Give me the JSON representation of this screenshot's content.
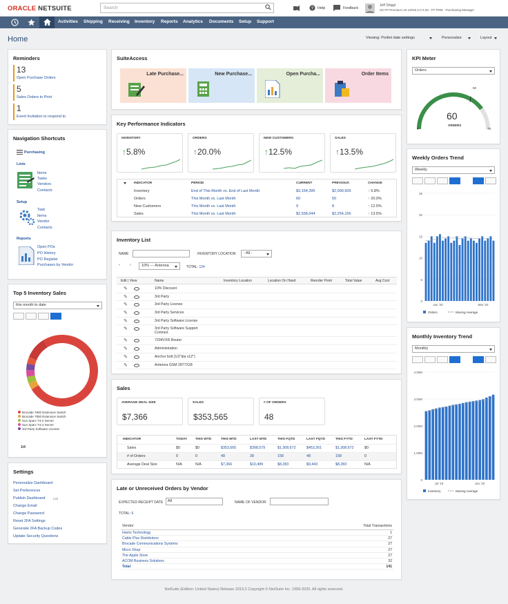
{
  "header": {
    "logo_oracle": "ORACLE",
    "logo_netsuite": "NETSUITE",
    "search_placeholder": "Search",
    "help": "Help",
    "feedback": "Feedback",
    "user_name": "Jeff Shippi",
    "user_role": "SS FP Premium US v2019.2.0 3.25 - FF PRM - Purchasing Manager"
  },
  "nav": {
    "items": [
      "Activities",
      "Shipping",
      "Receiving",
      "Inventory",
      "Reports",
      "Analytics",
      "Documents",
      "Setup",
      "Support"
    ]
  },
  "page": {
    "title": "Home",
    "viewing": "Viewing: Portlet date settings",
    "personalize": "Personalize",
    "layout": "Layout"
  },
  "reminders": {
    "title": "Reminders",
    "items": [
      {
        "count": "13",
        "label": "Open Purchase Orders",
        "color": "#e39a1e"
      },
      {
        "count": "5",
        "label": "Sales Orders to Print",
        "color": "#e39a1e"
      },
      {
        "count": "1",
        "label": "Event Invitation to respond to",
        "color": "#e39a1e"
      }
    ]
  },
  "navshortcuts": {
    "title": "Navigation Shortcuts",
    "purchasing": "Purchasing",
    "lists_label": "Lists",
    "lists": [
      "Items",
      "Tasks",
      "Vendors",
      "Contacts"
    ],
    "setup_label": "Setup",
    "setup": [
      "Task",
      "Items",
      "Vendor",
      "Contacts"
    ],
    "reports_label": "Reports",
    "reports": [
      "Open POs",
      "PO History",
      "PO Register",
      "Purchases by Vendor"
    ]
  },
  "top5": {
    "title": "Top 5 Inventory Sales",
    "range": "this month to date",
    "legend": [
      "Brocade 7800 Extension Switch",
      "Brocade 7800 Extension Switch",
      "Sun Sparc T4-2 Server",
      "Sun Sparc T4-2 Server",
      "3rd Party Software License"
    ],
    "pager": "1/4"
  },
  "settings": {
    "title": "Settings",
    "items": [
      "Personalize Dashboard",
      "Set Preferences",
      "Publish Dashboard",
      "Change Email",
      "Change Password",
      "Reset 2FA Settings",
      "Generate 2FA Backup Codes",
      "Update Security Questions"
    ],
    "publish_badge": "List"
  },
  "suiteaccess": {
    "title": "SuiteAccess",
    "tiles": [
      {
        "label": "Late Purchase...",
        "bg": "#fbe1d4"
      },
      {
        "label": "New Purchase...",
        "bg": "#d6e6f6"
      },
      {
        "label": "Open Purcha...",
        "bg": "#e4eed8"
      },
      {
        "label": "Order Items",
        "bg": "#f9d9e1"
      }
    ]
  },
  "kpi": {
    "title": "Key Performance Indicators",
    "boxes": [
      {
        "label": "INVENTORY",
        "value": "5.8%"
      },
      {
        "label": "ORDERS",
        "value": "20.0%"
      },
      {
        "label": "NEW CUSTOMERS",
        "value": "12.5%"
      },
      {
        "label": "SALES",
        "value": "13.5%"
      }
    ],
    "headers": [
      "INDICATOR",
      "PERIOD",
      "CURRENT",
      "PREVIOUS",
      "CHANGE"
    ],
    "rows": [
      {
        "ind": "Inventory",
        "period": "End of This Month vs. End of Last Month",
        "cur": "$3,164,395",
        "prev": "$2,990,505",
        "chg": "5.8%"
      },
      {
        "ind": "Orders",
        "period": "This Month vs. Last Month",
        "cur": "60",
        "prev": "50",
        "chg": "20.0%"
      },
      {
        "ind": "New Customers",
        "period": "This Month vs. Last Month",
        "cur": "9",
        "prev": "8",
        "chg": "12.5%"
      },
      {
        "ind": "Sales",
        "period": "This Month vs. Last Month",
        "cur": "$2,558,044",
        "prev": "$2,254,156",
        "chg": "13.5%"
      }
    ]
  },
  "invlist": {
    "title": "Inventory List",
    "name_label": "NAME",
    "loc_label": "INVENTORY LOCATION",
    "loc_value": "- All -",
    "page_sel": "10% --- Antenna",
    "total_label": "TOTAL:",
    "total": "124",
    "headers": [
      "Edit | View",
      "Name",
      "Inventory Location",
      "Location On Hand",
      "Reorder Point",
      "Total Value",
      "Avg Cost"
    ],
    "rows": [
      "10% Discount",
      "3rd Party",
      "3rd Party License",
      "3rd Party Services",
      "3rd Party Software License",
      "3rd Party Software Support Contract",
      "7204VXR Router",
      "Administration",
      "Anchor bolt (1/2\"dia x12\")",
      "Antenna GSM 2877X28"
    ]
  },
  "sales": {
    "title": "Sales",
    "boxes": [
      {
        "label": "AVERAGE DEAL SIZE",
        "value": "$7,366"
      },
      {
        "label": "SALES",
        "value": "$353,565"
      },
      {
        "label": "# OF ORDERS",
        "value": "48"
      }
    ],
    "headers": [
      "INDICATOR",
      "TODAY",
      "THIS WTD",
      "THIS MTD",
      "LAST MTD",
      "THIS FQTD",
      "LAST FQTD",
      "THIS FYTD",
      "LAST FYTD"
    ],
    "rows": [
      [
        "Sales",
        "$0",
        "$0",
        "$353,565",
        "$398,579",
        "$1,308,672",
        "$453,261",
        "$1,308,672",
        "$0"
      ],
      [
        "# of Orders",
        "0",
        "0",
        "48",
        "38",
        "158",
        "48",
        "158",
        "0"
      ],
      [
        "Average Deal Size",
        "N/A",
        "N/A",
        "$7,366",
        "$10,489",
        "$8,283",
        "$9,443",
        "$8,283",
        "N/A"
      ]
    ]
  },
  "lateorders": {
    "title": "Late or Unreceived Orders by Vendor",
    "receipt_label": "EXPECTED RECEIPT DATE",
    "receipt_value": "All",
    "vendor_label": "NAME OF VENDOR",
    "total_label": "TOTAL:",
    "total": "6",
    "headers": [
      "Vendor",
      "Total Transactions"
    ],
    "rows": [
      {
        "v": "Harris Technology",
        "n": "1"
      },
      {
        "v": "Cable Plus Distributors",
        "n": "27"
      },
      {
        "v": "Brocade Communications Systems",
        "n": "27"
      },
      {
        "v": "Micro Shop",
        "n": "27"
      },
      {
        "v": "The Apple Store",
        "n": "27"
      },
      {
        "v": "ACOM Business Solutions",
        "n": "32"
      },
      {
        "v": "Total",
        "n": "141"
      }
    ]
  },
  "kpimeter": {
    "title": "KPI Meter",
    "select": "Orders",
    "value": "60",
    "unit": "ORDERS",
    "min": "0",
    "mark": "50",
    "max": "75",
    "fraction": 0.8
  },
  "weekly": {
    "title": "Weekly Orders Trend",
    "select": "Weekly",
    "legend": [
      "Orders",
      "Moving Average"
    ]
  },
  "monthly": {
    "title": "Monthly Inventory Trend",
    "select": "Monthly",
    "legend": [
      "Inventory",
      "Moving Average"
    ]
  },
  "footer": "NetSuite (Edition: United States) Release 2019.2 Copyright © NetSuite Inc. 1999-2020. All rights reserved.",
  "chart_data": [
    {
      "type": "bar",
      "title": "Weekly Orders Trend",
      "x_ticks": [
        "Jan '20",
        "Mar '20"
      ],
      "ylim": [
        0,
        25
      ],
      "yticks": [
        "0",
        "5",
        "10",
        "15",
        "20",
        "25"
      ],
      "series": [
        {
          "name": "Orders",
          "values": [
            13.5,
            14,
            15,
            13.5,
            15,
            15.5,
            14,
            14.5,
            15,
            13.5,
            14,
            15,
            13,
            14.5,
            15,
            14,
            14.5,
            14,
            13.5,
            14.5,
            15,
            14,
            14.5,
            15,
            14
          ]
        },
        {
          "name": "Moving Average",
          "values": [
            14,
            14,
            14.2,
            14.3,
            14.5,
            14.6,
            14.7,
            14.6,
            14.7,
            14.6,
            14.6,
            14.7,
            14.5,
            14.6,
            14.7,
            14.6,
            14.6,
            14.5,
            14.5,
            14.5,
            14.6,
            14.5,
            14.6,
            14.6,
            14.5
          ]
        }
      ]
    },
    {
      "type": "bar",
      "title": "Monthly Inventory Trend",
      "x_ticks": [
        "Jul '19",
        "Jan '20"
      ],
      "ylim": [
        0,
        4000000
      ],
      "yticks": [
        "0",
        "1.00M",
        "2.00M",
        "3.00M",
        "4.00M"
      ],
      "series": [
        {
          "name": "Inventory",
          "values": [
            2550000,
            2580000,
            2620000,
            2650000,
            2680000,
            2700000,
            2720000,
            2750000,
            2780000,
            2800000,
            2820000,
            2850000,
            2880000,
            2900000,
            2920000,
            2940000,
            2960000,
            2990000,
            3050000,
            3100000,
            3160000
          ]
        },
        {
          "name": "Moving Average",
          "values": [
            2500000,
            2550000,
            2580000,
            2620000,
            2650000,
            2680000,
            2700000,
            2720000,
            2740000,
            2770000,
            2790000,
            2810000,
            2840000,
            2860000,
            2880000,
            2900000,
            2920000,
            2940000,
            2970000,
            3010000,
            3060000
          ]
        }
      ]
    },
    {
      "type": "pie",
      "title": "Top 5 Inventory Sales",
      "values": [
        75,
        3,
        3,
        3,
        3,
        3,
        10
      ],
      "colors": [
        "#d9453d",
        "#e8a33c",
        "#9fbf3d",
        "#d84f9e",
        "#7b4b9e",
        "#e35a3c",
        "#c73a36"
      ]
    }
  ]
}
